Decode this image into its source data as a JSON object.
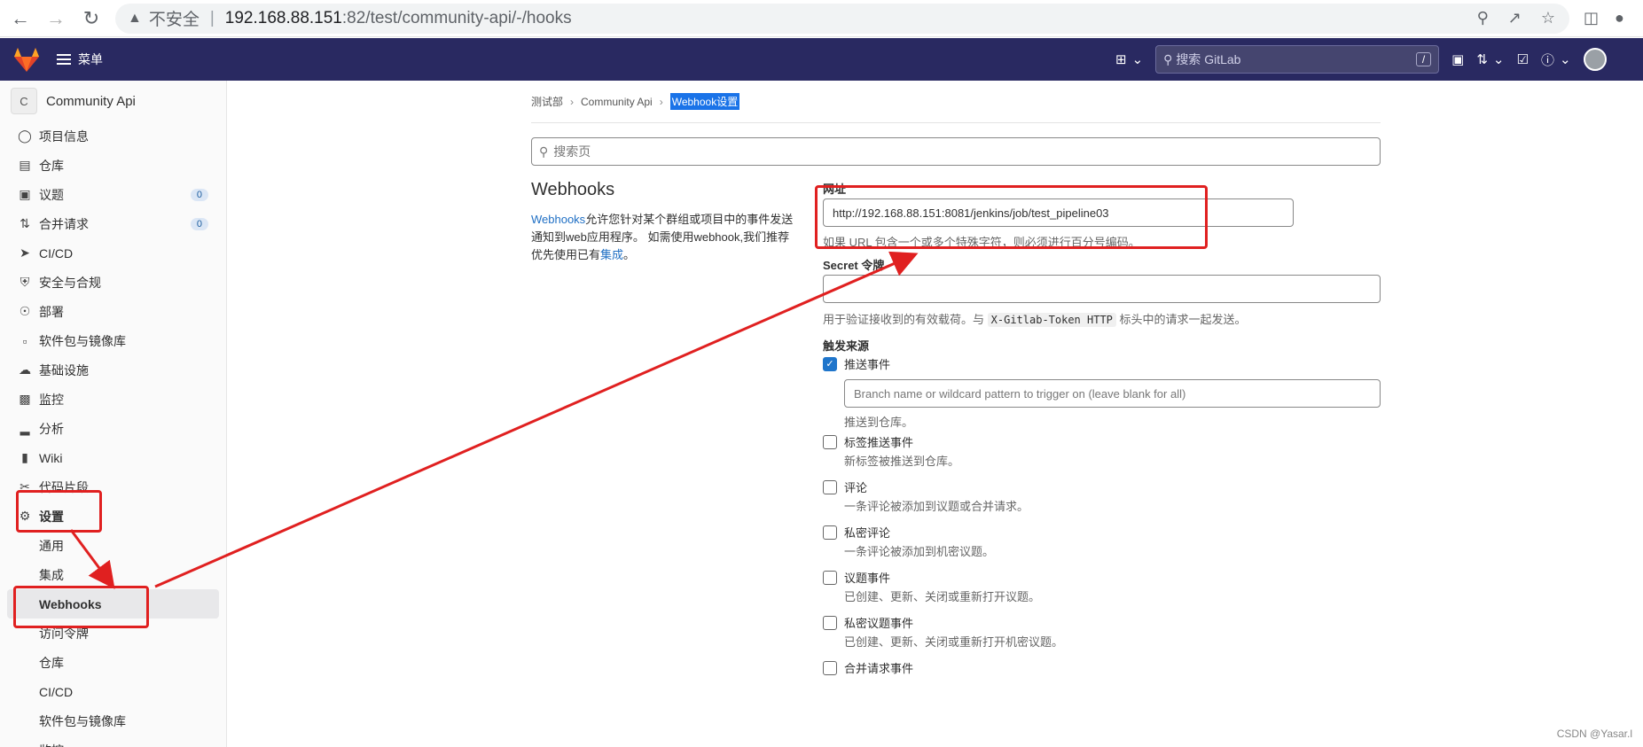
{
  "browser": {
    "security_label": "不安全",
    "separator": "|",
    "url_host": "192.168.88.151",
    "url_path": ":82/test/community-api/-/hooks"
  },
  "topbar": {
    "menu_label": "菜单",
    "search_placeholder": "搜索 GitLab",
    "search_shortcut": "/",
    "brand_color": "#292961"
  },
  "sidebar": {
    "project_initial": "C",
    "project_name": "Community Api",
    "items": [
      {
        "label": "项目信息",
        "icon": "info-icon"
      },
      {
        "label": "仓库",
        "icon": "doc-icon"
      },
      {
        "label": "议题",
        "icon": "issues-icon",
        "badge": "0"
      },
      {
        "label": "合并请求",
        "icon": "merge-icon",
        "badge": "0"
      },
      {
        "label": "CI/CD",
        "icon": "rocket-icon"
      },
      {
        "label": "安全与合规",
        "icon": "shield-icon"
      },
      {
        "label": "部署",
        "icon": "deploy-icon"
      },
      {
        "label": "软件包与镜像库",
        "icon": "package-icon"
      },
      {
        "label": "基础设施",
        "icon": "cloud-icon"
      },
      {
        "label": "监控",
        "icon": "monitor-icon"
      },
      {
        "label": "分析",
        "icon": "chart-icon"
      },
      {
        "label": "Wiki",
        "icon": "book-icon"
      },
      {
        "label": "代码片段",
        "icon": "scissors-icon"
      },
      {
        "label": "设置",
        "icon": "gear-icon"
      }
    ],
    "sub_items": [
      {
        "label": "通用"
      },
      {
        "label": "集成"
      },
      {
        "label": "Webhooks"
      },
      {
        "label": "访问令牌"
      },
      {
        "label": "仓库"
      },
      {
        "label": "CI/CD"
      },
      {
        "label": "软件包与镜像库"
      },
      {
        "label": "监控"
      }
    ]
  },
  "breadcrumb": {
    "level1": "测试部",
    "level2": "Community Api",
    "current": "Webhook设置"
  },
  "page_search": {
    "placeholder": "搜索页"
  },
  "intro": {
    "title": "Webhooks",
    "link1": "Webhooks",
    "text1": "允许您针对某个群组或项目中的事件发送通知到web应用程序。 如需使用webhook,我们推荐优先使用已有",
    "link2": "集成",
    "text2": "。"
  },
  "form": {
    "url_label": "网址",
    "url_value": "http://192.168.88.151:8081/jenkins/job/test_pipeline03",
    "url_help": "如果 URL 包含一个或多个特殊字符，则必须进行百分号编码。",
    "secret_label": "Secret 令牌",
    "secret_value": "",
    "secret_help_before": "用于验证接收到的有效载荷。与",
    "secret_help_code": "X-Gitlab-Token HTTP",
    "secret_help_after": "标头中的请求一起发送。",
    "triggers_label": "触发来源",
    "branch_placeholder": "Branch name or wildcard pattern to trigger on (leave blank for all)",
    "triggers": [
      {
        "label": "推送事件",
        "checked": true,
        "desc": "推送到仓库。"
      },
      {
        "label": "标签推送事件",
        "checked": false,
        "desc": "新标签被推送到仓库。"
      },
      {
        "label": "评论",
        "checked": false,
        "desc": "一条评论被添加到议题或合并请求。"
      },
      {
        "label": "私密评论",
        "checked": false,
        "desc": "一条评论被添加到机密议题。"
      },
      {
        "label": "议题事件",
        "checked": false,
        "desc": "已创建、更新、关闭或重新打开议题。"
      },
      {
        "label": "私密议题事件",
        "checked": false,
        "desc": "已创建、更新、关闭或重新打开机密议题。"
      },
      {
        "label": "合并请求事件",
        "checked": false,
        "desc": ""
      }
    ]
  },
  "annotation": {
    "color": "#e02020"
  },
  "watermark": "CSDN @Yasar.l"
}
